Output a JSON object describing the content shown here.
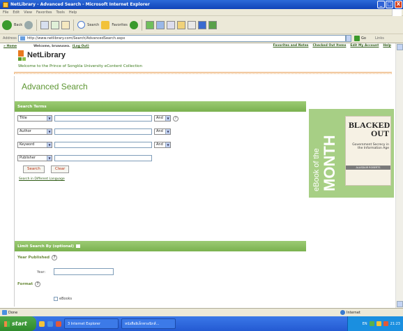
{
  "window": {
    "title": "NetLibrary - Advanced Search - Microsoft Internet Explorer",
    "min_label": "_",
    "max_label": "□",
    "close_label": "X"
  },
  "menu": [
    "File",
    "Edit",
    "View",
    "Favorites",
    "Tools",
    "Help"
  ],
  "toolbar": {
    "back_label": "Back",
    "search_label": "Search",
    "favorites_label": "Favorites"
  },
  "address": {
    "label": "Address",
    "url": "http://www.netlibrary.com/Search/AdvancedSearch.aspx",
    "go_label": "Go",
    "links_label": "Links"
  },
  "topnav": {
    "home": "» Home",
    "welcome": "Welcome, bruwusea.",
    "logout": "(Log Out)",
    "links": [
      "Favorites and Notes",
      "Checked Out Items",
      "Edit My Account",
      "Help"
    ]
  },
  "brand": {
    "logo_text": "NetLibrary",
    "welcome": "Welcome to the Prince of Songkla University eContent Collection"
  },
  "page_title": "Advanced Search",
  "search_terms": {
    "header": "Search Terms",
    "rows": [
      {
        "field": "Title",
        "operator": "And",
        "has_help": true
      },
      {
        "field": "Author",
        "operator": "And",
        "has_help": false
      },
      {
        "field": "Keyword",
        "operator": "And",
        "has_help": false
      },
      {
        "field": "Publisher",
        "operator": "",
        "has_help": false
      }
    ],
    "help_glyph": "?",
    "search_button": "Search",
    "clear_button": "Clear",
    "lang_link": "Search in Different Language"
  },
  "limit": {
    "header": "Limit Search By (optional)",
    "year_published": "Year Published",
    "year_label": "Year:",
    "format": "Format",
    "ebooks": "eBooks"
  },
  "promo": {
    "line1": "eBook of the",
    "line2": "MONTH",
    "book_title_1": "BLACKED",
    "book_title_2": "OUT",
    "book_subtitle": "Government Secrecy in the Information Age",
    "book_author": "ALASDAIR ROBERTS"
  },
  "status": {
    "done": "Done",
    "zone": "Internet"
  },
  "taskbar": {
    "start": "start",
    "tasks": [
      "3 Internet Explorer",
      "หนังสืออิเล็กทรอนิกส์..."
    ],
    "lang": "EN",
    "clock": "21:23"
  },
  "colors": {
    "accent_green": "#7ab14f",
    "logo_orange": "#e8791e",
    "title_green": "#5d9632"
  }
}
